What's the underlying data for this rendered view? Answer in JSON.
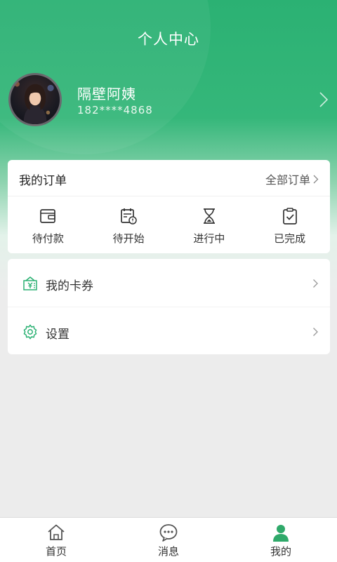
{
  "header": {
    "title": "个人中心"
  },
  "profile": {
    "name": "隔壁阿姨",
    "phone": "182****4868"
  },
  "orders": {
    "title": "我的订单",
    "all_label": "全部订单",
    "items": [
      {
        "label": "待付款",
        "icon": "wallet-icon"
      },
      {
        "label": "待开始",
        "icon": "calendar-alert-icon"
      },
      {
        "label": "进行中",
        "icon": "hourglass-icon"
      },
      {
        "label": "已完成",
        "icon": "clipboard-check-icon"
      }
    ]
  },
  "menu": {
    "items": [
      {
        "label": "我的卡券",
        "icon": "coupon-icon"
      },
      {
        "label": "设置",
        "icon": "gear-icon"
      }
    ]
  },
  "tabbar": {
    "items": [
      {
        "label": "首页",
        "icon": "home-icon",
        "active": false
      },
      {
        "label": "消息",
        "icon": "message-icon",
        "active": false
      },
      {
        "label": "我的",
        "icon": "user-icon",
        "active": true
      }
    ]
  },
  "colors": {
    "accent": "#2bb173",
    "tab_active": "#2fa96a",
    "tab_inactive": "#555555"
  }
}
